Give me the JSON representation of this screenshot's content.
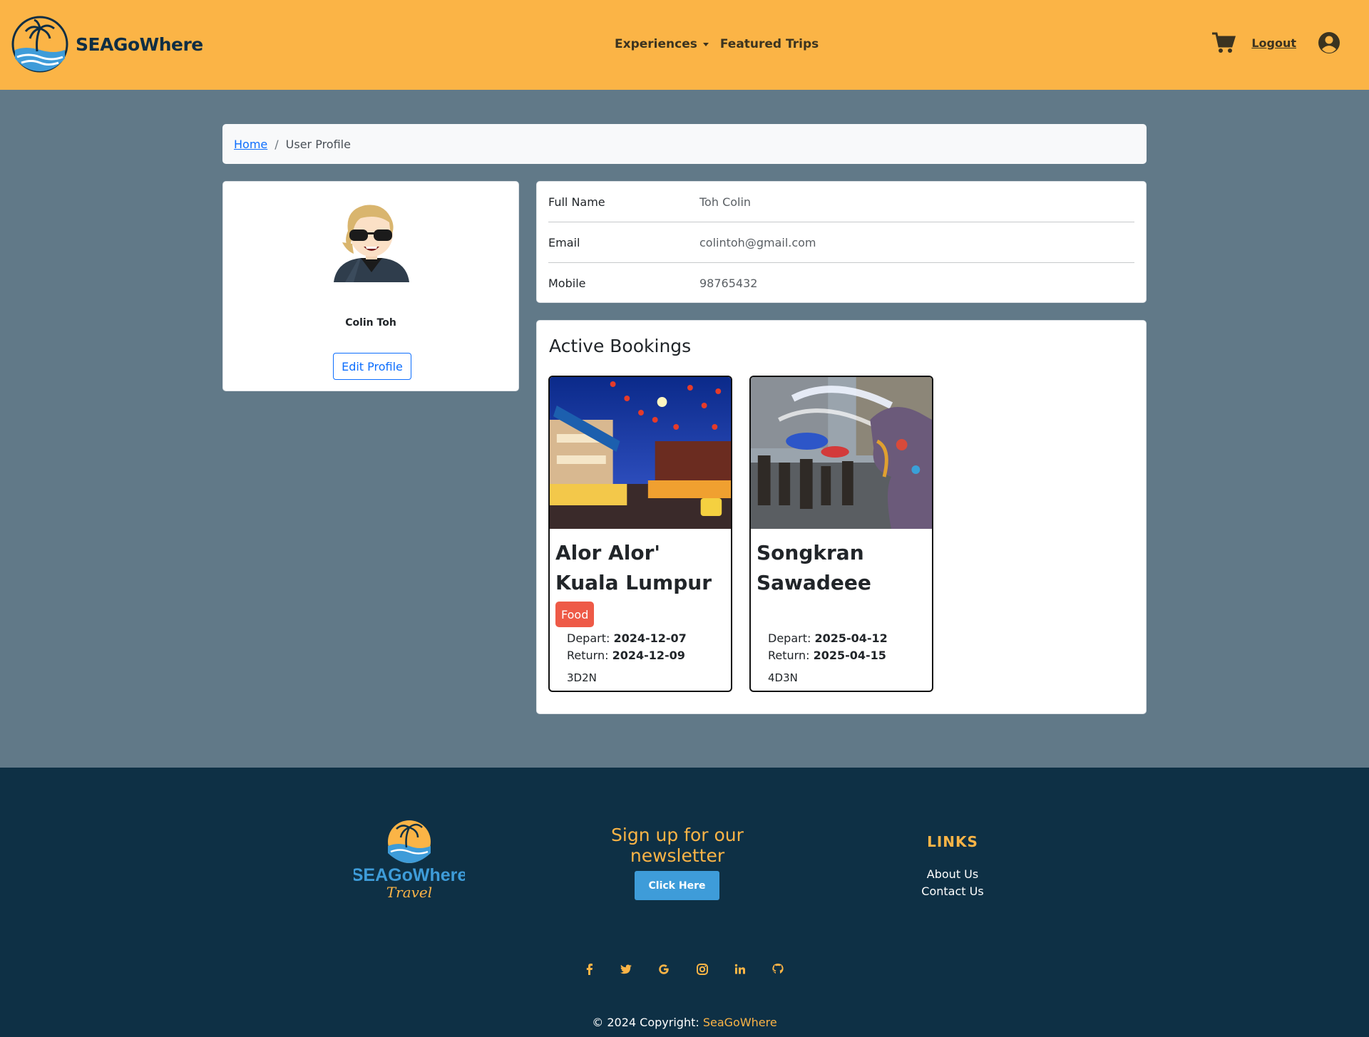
{
  "navbar": {
    "brand_name": "SEAGoWhere",
    "nav_items": [
      {
        "label": "Experiences",
        "has_dropdown": true
      },
      {
        "label": "Featured Trips",
        "has_dropdown": false
      }
    ],
    "logout_label": "Logout",
    "cart_icon": "shopping-cart-icon",
    "user_icon": "user-circle-icon"
  },
  "breadcrumb": {
    "home_label": "Home",
    "separator": "/",
    "current_label": "User Profile"
  },
  "profile": {
    "name": "Colin Toh",
    "edit_button_label": "Edit Profile",
    "details": [
      {
        "label": "Full Name",
        "value": "Toh Colin"
      },
      {
        "label": "Email",
        "value": "colintoh@gmail.com"
      },
      {
        "label": "Mobile",
        "value": "98765432"
      }
    ]
  },
  "bookings": {
    "title": "Active Bookings",
    "items": [
      {
        "title": "Alor Alor' Kuala Lumpur",
        "tag": "Food",
        "depart_label": "Depart:",
        "depart_date": "2024-12-07",
        "return_label": "Return:",
        "return_date": "2024-12-09",
        "duration": "3D2N"
      },
      {
        "title": "Songkran Sawadeee",
        "tag": "",
        "depart_label": "Depart:",
        "depart_date": "2025-04-12",
        "return_label": "Return:",
        "return_date": "2025-04-15",
        "duration": "4D3N"
      }
    ]
  },
  "footer": {
    "logo_text": "SEAGoWhere",
    "logo_script": "Travel",
    "newsletter_title": "Sign up for our newsletter",
    "newsletter_button": "Click Here",
    "links_title": "LINKS",
    "links": [
      "About Us",
      "Contact Us"
    ],
    "social_icons": [
      "facebook-icon",
      "twitter-icon",
      "google-icon",
      "instagram-icon",
      "linkedin-icon",
      "github-icon"
    ],
    "copyright_prefix": "© 2024 Copyright:",
    "copyright_brand": "SeaGoWhere"
  },
  "colors": {
    "navbar": "#fbb446",
    "background": "#617988",
    "footer": "#0e3045",
    "accent": "#fbb446",
    "badge": "#ee5a47",
    "primary": "#0d6efd"
  }
}
